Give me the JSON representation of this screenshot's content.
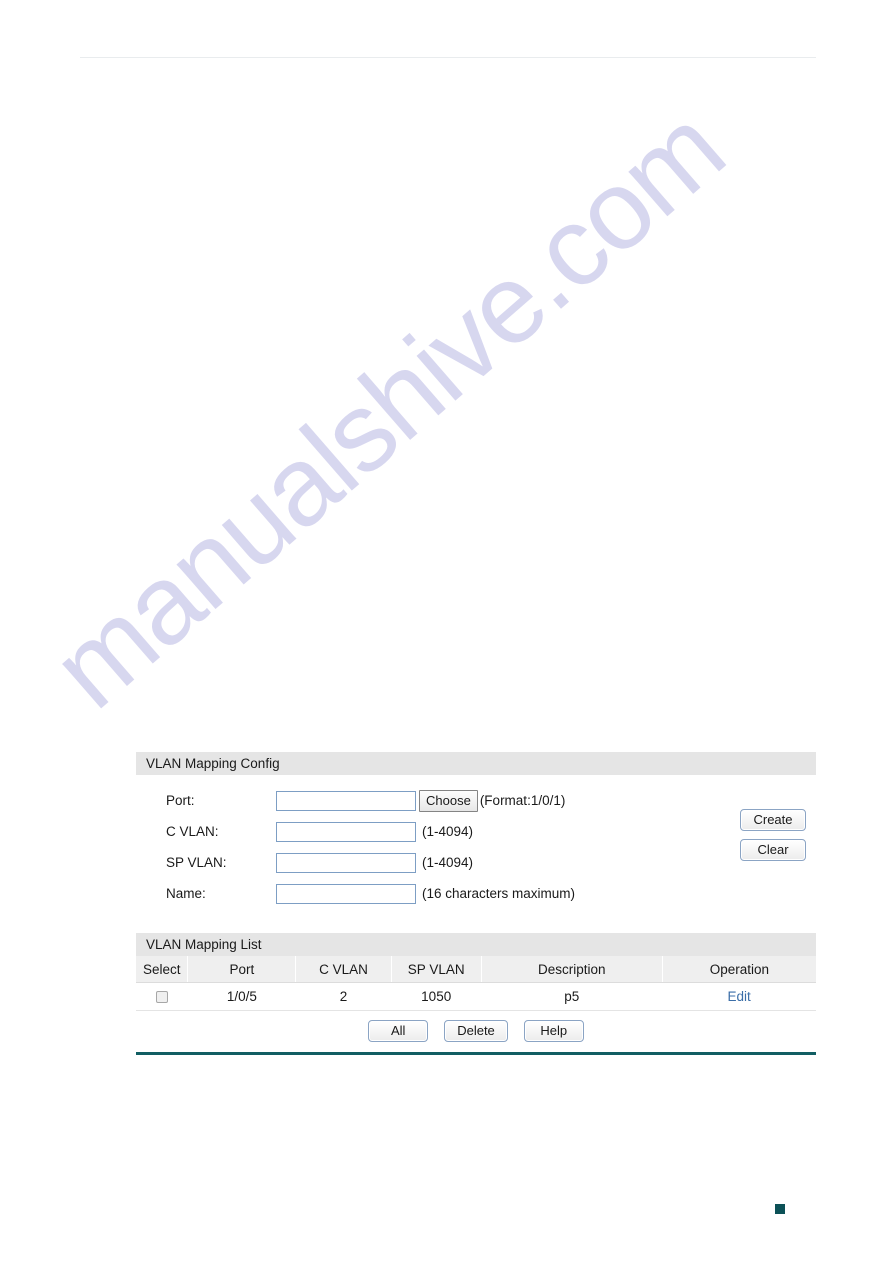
{
  "page": {
    "accent_teal": "#0c5157",
    "top_rule_color": "#e9ecee",
    "watermark_text": "manualshive.com",
    "watermark_color": "#c9c8ea"
  },
  "config_panel": {
    "title": "VLAN Mapping Config",
    "fields": [
      {
        "label": "Port:",
        "value": "",
        "placeholder": "",
        "hint": "(Format:1/0/1)"
      },
      {
        "label": "C VLAN:",
        "value": "",
        "placeholder": "",
        "hint": "(1-4094)"
      },
      {
        "label": "SP VLAN:",
        "value": "",
        "placeholder": "",
        "hint": "(1-4094)"
      },
      {
        "label": "Name:",
        "value": "",
        "placeholder": "",
        "hint": "(16 characters maximum)"
      }
    ],
    "choose_button": "Choose",
    "create_button": "Create",
    "clear_button": "Clear"
  },
  "list_panel": {
    "title": "VLAN Mapping List",
    "columns": [
      "Select",
      "Port",
      "C VLAN",
      "SP VLAN",
      "Description",
      "Operation"
    ],
    "rows": [
      {
        "select": false,
        "port": "1/0/5",
        "c_vlan": "2",
        "sp_vlan": "1050",
        "description": "p5",
        "operation": "Edit"
      }
    ],
    "actions": {
      "all": "All",
      "delete": "Delete",
      "help": "Help"
    }
  }
}
